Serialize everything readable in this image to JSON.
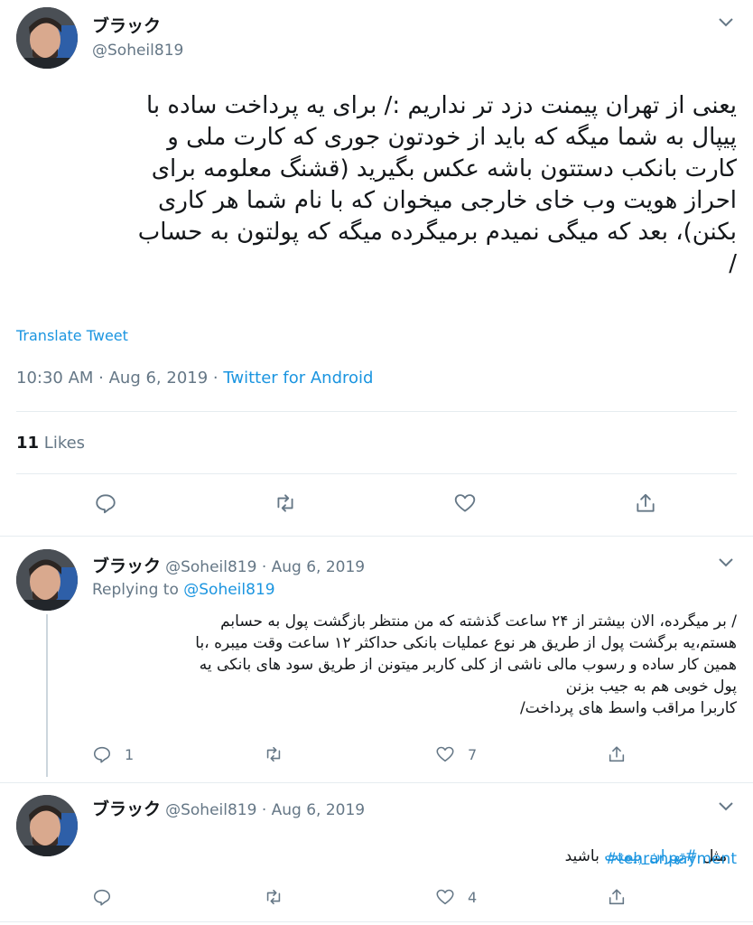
{
  "main_tweet": {
    "display_name": "ブラック",
    "handle": "@Soheil819",
    "text": "یعنی از تهران پیمنت دزد تر نداریم :/ برای یه پرداخت ساده با\nپیپال به شما میگه که باید از خودتون جوری که کارت ملی و\nکارت بانکب دستتون باشه عکس بگیرید (قشنگ معلومه برای\nاحراز هویت وب خای خارجی میخوان که با نام شما هر کاری\nبکنن)، بعد که میگی نمیدم برمیگرده میگه که پولتون به حساب\n/",
    "translate_label": "Translate Tweet",
    "time": "10:30 AM · Aug 6, 2019 · ",
    "source": "Twitter for Android",
    "likes_count": "11",
    "likes_label": " Likes"
  },
  "replies": [
    {
      "display_name": "ブラック",
      "meta": "@Soheil819 · Aug 6, 2019",
      "replying_prefix": "Replying to ",
      "replying_handle": "@Soheil819",
      "text": "/ بر میگرده، الان بیشتر از ۲۴ ساعت گذشته که من منتظر بازگشت پول به حسابم\nهستم،یه برگشت پول از طریق هر نوع عملیات بانکی حداکثر ۱۲ ساعت وقت میبره ،با\nهمین کار ساده و رسوب مالی ناشی از کلی کاربر میتونن از طریق سود های بانکی یه\nپول خوبی هم به جیب بزنن\nکاربرا مراقب واسط های پرداخت/",
      "reply_count": "1",
      "retweet_count": "",
      "like_count": "7"
    },
    {
      "display_name": "ブラック",
      "meta": "@Soheil819 · Aug 6, 2019",
      "text_prefix": "مثل ",
      "hashtag_fa": "#تهران_پیمنت",
      "text_suffix": " باشید",
      "hashtag_en": "#tehranpayment",
      "reply_count": "",
      "retweet_count": "",
      "like_count": "4"
    }
  ],
  "icons": {
    "reply": "reply-icon",
    "retweet": "retweet-icon",
    "like": "heart-icon",
    "share": "share-icon",
    "more": "chevron-down-icon"
  },
  "colors": {
    "link": "#1b95e0",
    "secondary": "#657786",
    "divider": "#e6ecf0"
  }
}
